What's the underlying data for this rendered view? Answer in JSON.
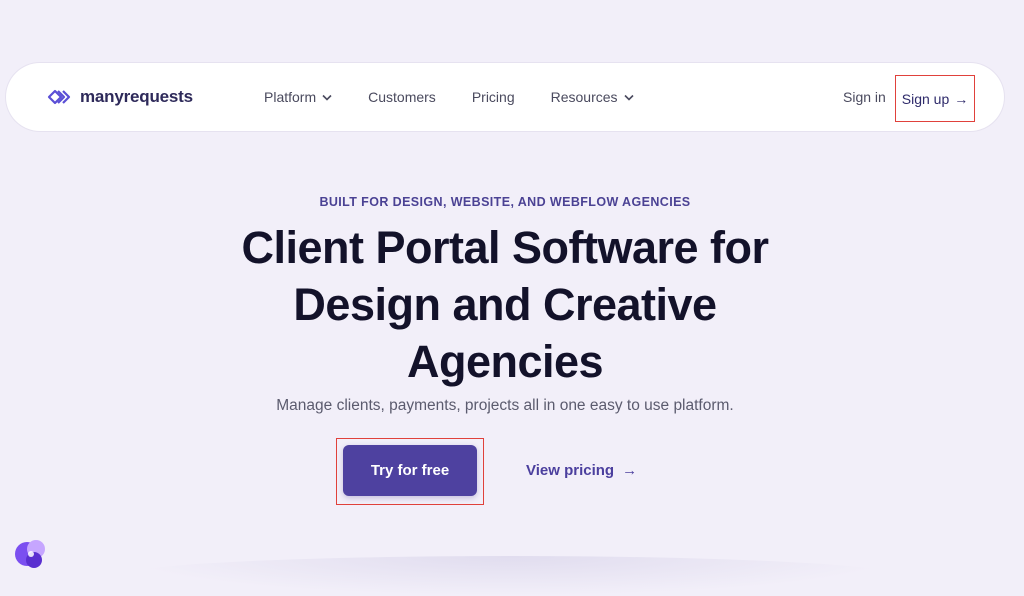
{
  "brand": {
    "name": "manyrequests",
    "logo_icon": "double-chevron-logo-icon",
    "accent_color": "#4e41a0"
  },
  "nav": {
    "links": [
      {
        "label": "Platform",
        "has_dropdown": true
      },
      {
        "label": "Customers",
        "has_dropdown": false
      },
      {
        "label": "Pricing",
        "has_dropdown": false
      },
      {
        "label": "Resources",
        "has_dropdown": true
      }
    ],
    "sign_in": "Sign in",
    "sign_up": "Sign up",
    "sign_up_arrow": "→"
  },
  "hero": {
    "eyebrow": "BUILT FOR DESIGN, WEBSITE, AND WEBFLOW AGENCIES",
    "headline_lines": [
      "Client Portal Software for",
      "Design and Creative",
      "Agencies"
    ],
    "subhead": "Manage clients, payments, projects all in one easy to use platform.",
    "primary_cta": "Try for free",
    "secondary_cta": "View pricing",
    "secondary_cta_arrow": "→"
  },
  "colors": {
    "background": "#f2eff9",
    "highlight_box": "#e0413b",
    "primary_button": "#4e41a0"
  }
}
